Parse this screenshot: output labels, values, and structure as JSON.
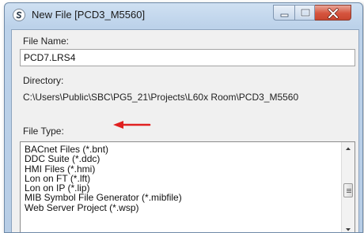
{
  "window": {
    "title": "New File [PCD3_M5560]"
  },
  "form": {
    "file_name_label": "File Name:",
    "file_name_value": "PCD7.LRS4",
    "directory_label": "Directory:",
    "directory_value": "C:\\Users\\Public\\SBC\\PG5_21\\Projects\\L60x Room\\PCD3_M5560",
    "file_type_label": "File Type:"
  },
  "file_types": [
    "BACnet Files (*.bnt)",
    "DDC Suite (*.ddc)",
    "HMI Files (*.hmi)",
    "Lon on FT (*.lft)",
    "Lon on IP (*.lip)",
    "MIB Symbol File Generator (*.mibfile)",
    "Web Server Project (*.wsp)"
  ],
  "colors": {
    "annotation_arrow": "#e02020",
    "close_button": "#d5543e"
  }
}
